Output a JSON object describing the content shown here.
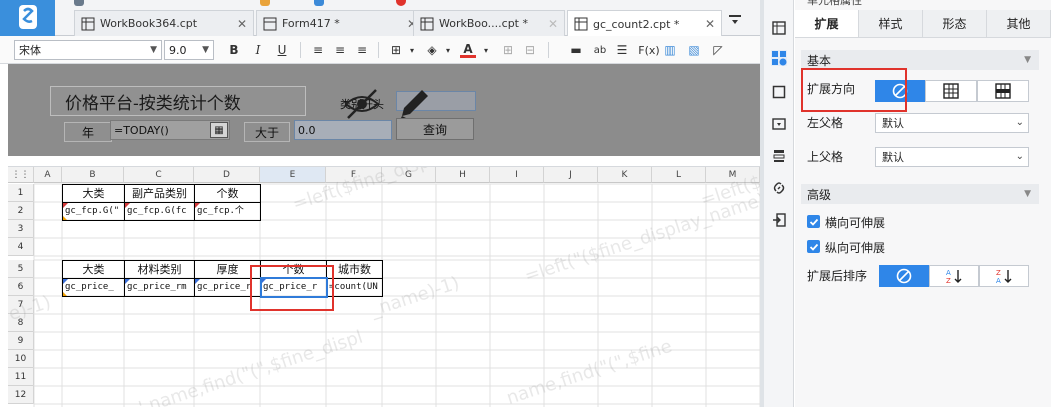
{
  "tabs": [
    {
      "label": "WorkBook364.cpt",
      "modified": false
    },
    {
      "label": "Form417 *",
      "modified": true
    },
    {
      "label": "WorkBoo....cpt *",
      "modified": true
    },
    {
      "label": "gc_count2.cpt *",
      "modified": true
    }
  ],
  "toolbar": {
    "font": "宋体",
    "size": "9.0"
  },
  "param_pane": {
    "title": "价格平台-按类统计个数",
    "label_category": "类别开头",
    "label_year": "年",
    "year_value": "=TODAY()",
    "label_greater": "大于",
    "greater_value": "0.0",
    "query_button": "查询"
  },
  "sheet": {
    "columns": [
      "A",
      "B",
      "C",
      "D",
      "E",
      "F",
      "G",
      "H",
      "I",
      "J",
      "K",
      "L",
      "M"
    ],
    "rows": [
      "1",
      "2",
      "3",
      "4",
      "5",
      "6",
      "7",
      "8",
      "9",
      "10",
      "11",
      "12"
    ],
    "cells": {
      "r1": [
        "大类",
        "副产品类别",
        "个数"
      ],
      "r2": [
        "gc_fcp.G(\"",
        "gc_fcp.G(fc",
        "gc_fcp.个"
      ],
      "r5": [
        "大类",
        "材料类别",
        "厚度",
        "个数",
        "城市数"
      ],
      "r6": [
        "gc_price_",
        "gc_price_rm",
        "gc_price_r",
        "gc_price_r",
        "=count(UN"
      ]
    },
    "watermarks": [
      "=left($fine_disp",
      "=left($fin",
      "e)-1)",
      "_name)-1)",
      "=left(\"($fine_display_name)-1)",
      "'.name,find(\"(\",$fine_displ",
      "name,find(\"(\",$fine"
    ]
  },
  "right_panel": {
    "top_label": "单元格属性",
    "tabs": [
      "扩展",
      "样式",
      "形态",
      "其他"
    ],
    "section_basic": "基本",
    "expand_direction_label": "扩展方向",
    "left_parent_label": "左父格",
    "left_parent_value": "默认",
    "top_parent_label": "上父格",
    "top_parent_value": "默认",
    "section_advanced": "高级",
    "horizontal_expandable": "横向可伸展",
    "vertical_expandable": "纵向可伸展",
    "sort_after_expand_label": "扩展后排序"
  },
  "colors": {
    "accent": "#2f86e8",
    "highlight_red": "#e0332c",
    "param_bg": "#8c8c8c"
  }
}
